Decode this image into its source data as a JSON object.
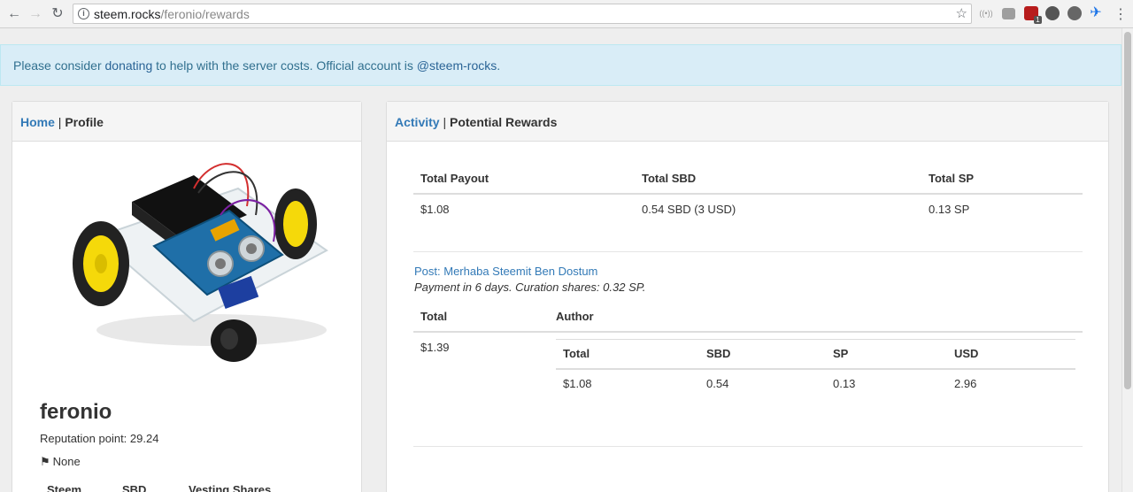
{
  "browser": {
    "url_host": "steem.rocks",
    "url_path": "/feronio/rewards",
    "ext_badge": "1"
  },
  "alert": {
    "prefix": "Please consider ",
    "donate_link": "donating",
    "middle": " to help with the server costs. Official account is ",
    "account_link": "@steem-rocks",
    "suffix": "."
  },
  "left_panel": {
    "breadcrumb_home": "Home",
    "breadcrumb_sep": " | ",
    "breadcrumb_current": "Profile",
    "name": "feronio",
    "reputation": "Reputation point: 29.24",
    "location": "None",
    "table_headers": [
      "Steem",
      "SBD",
      "Vesting Shares"
    ]
  },
  "right_panel": {
    "breadcrumb_activity": "Activity",
    "breadcrumb_sep": " | ",
    "breadcrumb_current": "Potential Rewards",
    "summary": {
      "headers": [
        "Total Payout",
        "Total SBD",
        "Total SP"
      ],
      "row": [
        "$1.08",
        "0.54 SBD (3 USD)",
        "0.13 SP"
      ]
    },
    "post": {
      "title": "Post: Merhaba Steemit Ben Dostum",
      "meta": "Payment in 6 days. Curation shares: 0.32 SP.",
      "headers": [
        "Total",
        "Author"
      ],
      "total": "$1.39",
      "author_table": {
        "headers": [
          "Total",
          "SBD",
          "SP",
          "USD"
        ],
        "row": [
          "$1.08",
          "0.54",
          "0.13",
          "2.96"
        ]
      }
    }
  }
}
